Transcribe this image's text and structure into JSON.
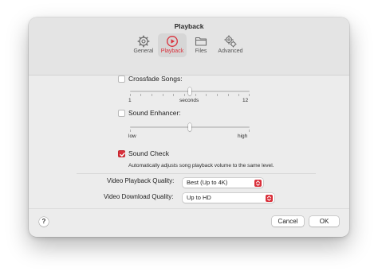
{
  "window": {
    "title": "Playback"
  },
  "tabs": [
    {
      "label": "General",
      "icon": "gear-icon",
      "active": false
    },
    {
      "label": "Playback",
      "icon": "play-circle-icon",
      "active": true
    },
    {
      "label": "Files",
      "icon": "folder-icon",
      "active": false
    },
    {
      "label": "Advanced",
      "icon": "gears-icon",
      "active": false
    }
  ],
  "crossfade": {
    "label": "Crossfade Songs:",
    "checked": false,
    "min_label": "1",
    "mid_label": "seconds",
    "max_label": "12"
  },
  "enhancer": {
    "label": "Sound Enhancer:",
    "checked": false,
    "min_label": "low",
    "max_label": "high"
  },
  "sound_check": {
    "label": "Sound Check",
    "checked": true,
    "description": "Automatically adjusts song playback volume to the same level."
  },
  "video_playback": {
    "label": "Video Playback Quality:",
    "value": "Best (Up to 4K)"
  },
  "video_download": {
    "label": "Video Download Quality:",
    "value": "Up to HD"
  },
  "footer": {
    "help_label": "?",
    "cancel_label": "Cancel",
    "ok_label": "OK"
  },
  "colors": {
    "accent": "#d9303b",
    "window_bg": "#ececec"
  }
}
